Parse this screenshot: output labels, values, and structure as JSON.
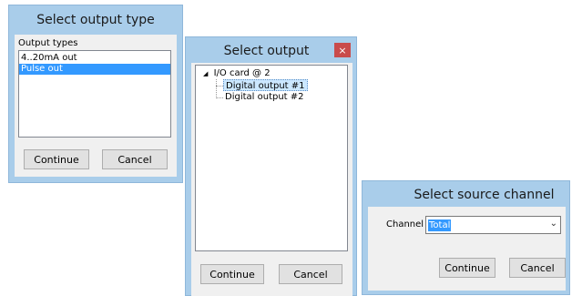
{
  "dialog1": {
    "title": "Select output type",
    "list_label": "Output types",
    "items": [
      "4..20mA out",
      "Pulse out"
    ],
    "selected_index": 1,
    "continue_label": "Continue",
    "cancel_label": "Cancel"
  },
  "dialog2": {
    "title": "Select output",
    "close_label": "×",
    "tree_root": "I/O card @ 2",
    "tree_children": [
      "Digital output #1",
      "Digital output #2"
    ],
    "selected_index": 0,
    "continue_label": "Continue",
    "cancel_label": "Cancel"
  },
  "dialog3": {
    "title": "Select source channel",
    "channel_label": "Channel",
    "channel_value": "Total",
    "continue_label": "Continue",
    "cancel_label": "Cancel"
  },
  "colors": {
    "frame": "#a9cdea",
    "client": "#f0f0f0",
    "selection": "#3399ff",
    "close": "#c94b4b"
  }
}
